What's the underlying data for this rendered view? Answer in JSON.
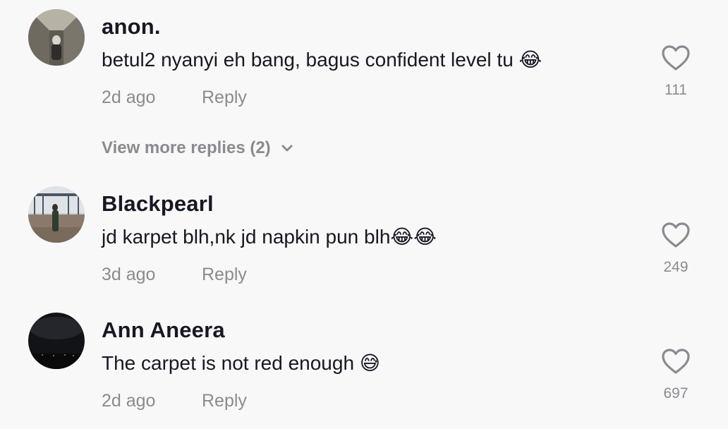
{
  "comments": [
    {
      "username": "anon.",
      "text": "betul2 nyanyi eh bang, bagus confident level tu 😂",
      "time": "2d ago",
      "reply_label": "Reply",
      "likes": "111",
      "more_replies": "View more replies (2)"
    },
    {
      "username": "Blackpearl",
      "text": "jd karpet blh,nk jd napkin pun blh😂😂",
      "time": "3d ago",
      "reply_label": "Reply",
      "likes": "249"
    },
    {
      "username": "Ann Aneera",
      "text": "The carpet is not red enough 😅",
      "time": "2d ago",
      "reply_label": "Reply",
      "likes": "697"
    }
  ],
  "icons": {
    "like": "heart-outline-icon",
    "expand": "chevron-down-icon"
  },
  "colors": {
    "text_primary": "#161823",
    "text_secondary": "#8a8b91",
    "background": "#f8f8f8"
  }
}
